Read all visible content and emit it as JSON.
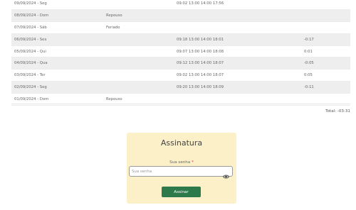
{
  "rows": [
    {
      "date": "09/09/2024 - Seg",
      "note": "",
      "times": "09:02 13:00 14:00 17:56",
      "balance": "",
      "shaded": false
    },
    {
      "date": "08/09/2024 - Dom",
      "note": "Repouso",
      "times": "",
      "balance": "",
      "shaded": true
    },
    {
      "date": "07/09/2024 - Sáb",
      "note": "Feriado",
      "times": "",
      "balance": "",
      "shaded": false
    },
    {
      "date": "06/09/2024 - Sex",
      "note": "",
      "times": "09:18 13:00 14:00 18:01",
      "balance": "-0:17",
      "shaded": true
    },
    {
      "date": "05/09/2024 - Qui",
      "note": "",
      "times": "09:07 13:00 14:00 18:08",
      "balance": "0:01",
      "shaded": false
    },
    {
      "date": "04/09/2024 - Qua",
      "note": "",
      "times": "09:12 13:00 14:00 18:07",
      "balance": "-0:05",
      "shaded": true
    },
    {
      "date": "03/09/2024 - Ter",
      "note": "",
      "times": "09:02 13:00 14:00 18:07",
      "balance": "0:05",
      "shaded": false
    },
    {
      "date": "02/09/2024 - Seg",
      "note": "",
      "times": "09:20 13:00 14:00 18:09",
      "balance": "-0:11",
      "shaded": true
    },
    {
      "date": "01/09/2024 - Dom",
      "note": "Repouso",
      "times": "",
      "balance": "",
      "shaded": false
    }
  ],
  "total": "Total: -03:31",
  "signature": {
    "title": "Assinatura",
    "password_label": "Sua senha",
    "required_mark": "*",
    "password_placeholder": "Sua senha",
    "password_value": "",
    "submit_label": "Assinar"
  },
  "colors": {
    "card_background": "#fcf0c8",
    "button_green": "#2c7a4b",
    "row_shade": "#eeeeee",
    "required_red": "#c93030"
  },
  "icons": {
    "password_toggle": "eye-icon"
  }
}
